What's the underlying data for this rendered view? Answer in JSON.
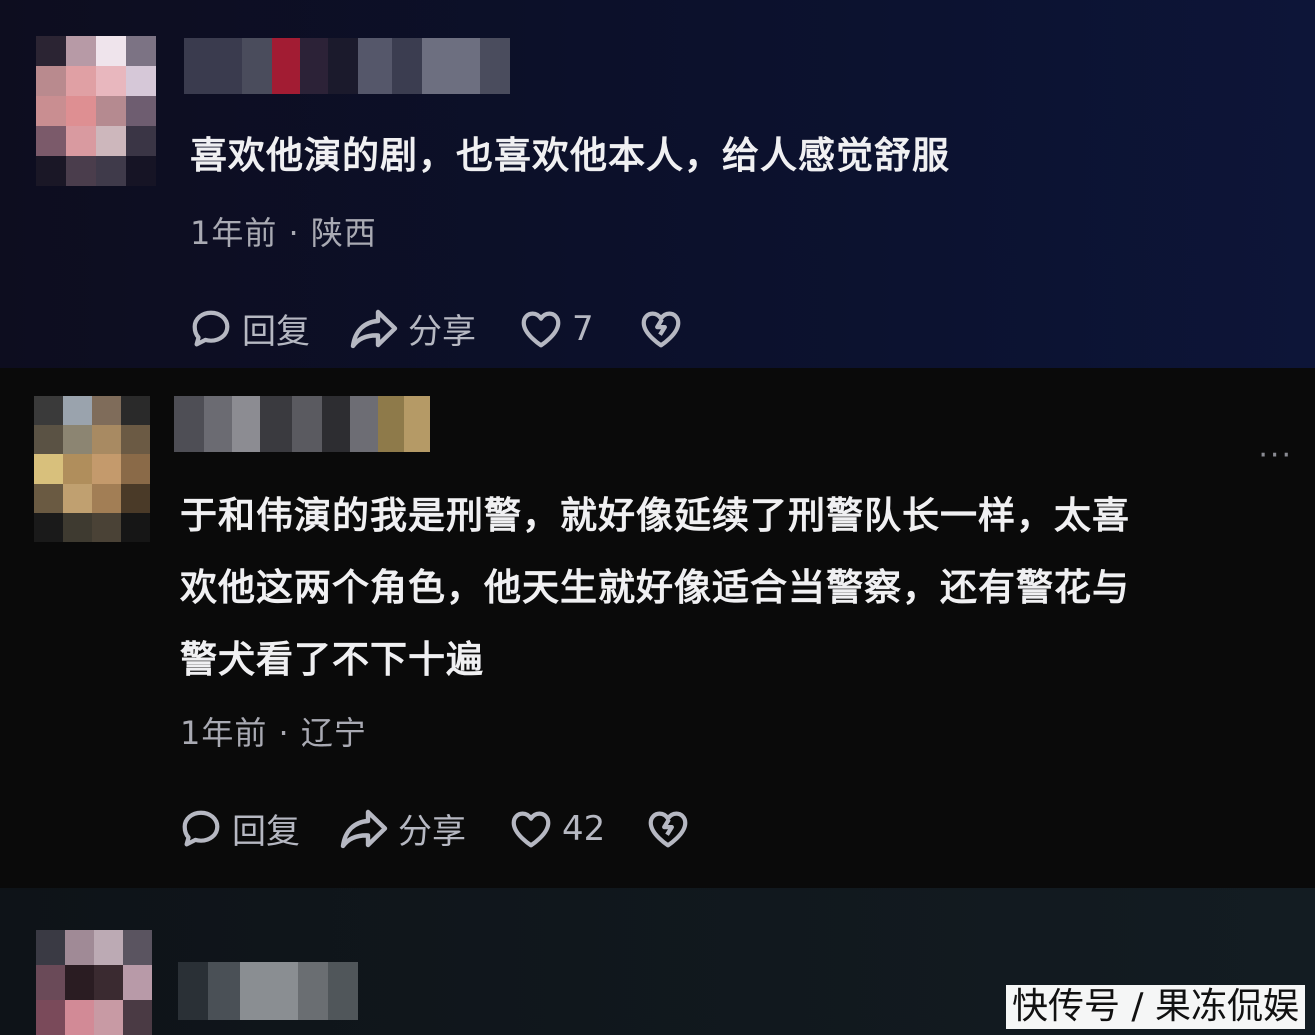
{
  "comments": [
    {
      "text": "喜欢他演的剧，也喜欢他本人，给人感觉舒服",
      "meta": "1年前 · 陕西",
      "reply_label": "回复",
      "share_label": "分享",
      "like_count": "7"
    },
    {
      "text_lines": [
        "于和伟演的我是刑警，就好像延续了刑警队长一样，太喜",
        "欢他这两个角色，他天生就好像适合当警察，还有警花与",
        "警犬看了不下十遍"
      ],
      "meta": "1年前 · 辽宁",
      "reply_label": "回复",
      "share_label": "分享",
      "like_count": "42",
      "more_label": "···"
    }
  ],
  "watermark": "快传号 / 果冻侃娱",
  "icons": {
    "comment": "speech-bubble-icon",
    "share": "share-arrow-icon",
    "like": "heart-icon",
    "dislike": "broken-heart-icon",
    "more": "more-dots-icon"
  },
  "colors": {
    "text": "#f0f0f2",
    "meta": "#a9aab3",
    "action": "#b6b8c2"
  }
}
